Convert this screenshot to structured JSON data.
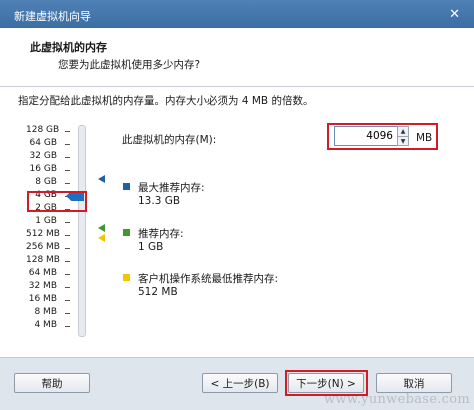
{
  "window": {
    "title": "新建虚拟机向导",
    "close_glyph": "✕"
  },
  "header": {
    "title": "此虚拟机的内存",
    "subtitle": "您要为此虚拟机使用多少内存?"
  },
  "main": {
    "instruction": "指定分配给此虚拟机的内存量。内存大小必须为 4 MB 的倍数。",
    "memory_scale": [
      "128 GB",
      "64 GB",
      "32 GB",
      "16 GB",
      "8 GB",
      "4 GB",
      "2 GB",
      "1 GB",
      "512 MB",
      "256 MB",
      "128 MB",
      "64 MB",
      "32 MB",
      "16 MB",
      "8 MB",
      "4 MB"
    ],
    "selected_scale_label": "4 GB",
    "memory_field_label": "此虚拟机的内存(M):",
    "memory_value": "4096",
    "memory_unit": "MB",
    "legend": [
      {
        "title": "最大推荐内存:",
        "value": "13.3 GB",
        "color": "#1f5fa8",
        "icon": "blue-square-icon"
      },
      {
        "title": "推荐内存:",
        "value": "1 GB",
        "color": "#3f9a2c",
        "icon": "green-square-icon"
      },
      {
        "title": "客户机操作系统最低推荐内存:",
        "value": "512 MB",
        "color": "#f2c500",
        "icon": "yellow-square-icon"
      }
    ]
  },
  "footer": {
    "help_label": "帮助",
    "back_label": "< 上一步(B)",
    "next_label": "下一步(N) >",
    "cancel_label": "取消"
  },
  "watermark": "www.yunwebase.com",
  "colors": {
    "titlebar": "#3b6ea3",
    "highlight_red": "#d11b26",
    "slider_thumb": "#1d6fc4"
  }
}
